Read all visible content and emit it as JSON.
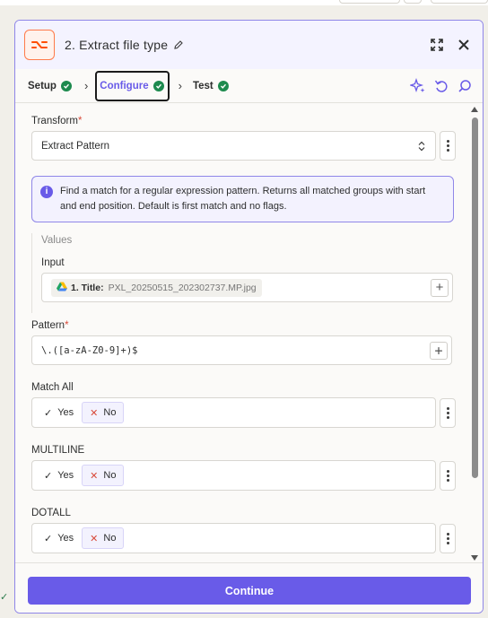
{
  "header": {
    "title": "2. Extract file type",
    "icons": {
      "app": "formatter-icon",
      "edit": "pencil-icon",
      "expand": "expand-icon",
      "close": "close-icon"
    }
  },
  "tabs": [
    {
      "label": "Setup",
      "done": true
    },
    {
      "label": "Configure",
      "done": true,
      "active": true
    },
    {
      "label": "Test",
      "done": true
    }
  ],
  "tools": [
    "sparkle-icon",
    "undo-icon",
    "search-icon"
  ],
  "form": {
    "transform_label": "Transform",
    "transform_value": "Extract Pattern",
    "info_text": "Find a match for a regular expression pattern. Returns all matched groups with start and end position. Default is first match and no flags.",
    "values_title": "Values",
    "input_label": "Input",
    "input_pill": {
      "step": "1. Title:",
      "value": "PXL_20250515_202302737.MP.jpg",
      "icon": "google-drive-icon"
    },
    "pattern_label": "Pattern",
    "pattern_value": "\\.([a-zA-Z0-9]+)$",
    "toggles": [
      {
        "label": "Match All",
        "yes": "Yes",
        "no": "No",
        "selected": "No"
      },
      {
        "label": "MULTILINE",
        "yes": "Yes",
        "no": "No",
        "selected": "No"
      },
      {
        "label": "DOTALL",
        "yes": "Yes",
        "no": "No",
        "selected": "No"
      }
    ]
  },
  "footer": {
    "continue_label": "Continue"
  },
  "colors": {
    "accent": "#695be8",
    "success": "#1d8a4e",
    "brand_orange": "#ff4f00",
    "required": "#d84a3a"
  }
}
